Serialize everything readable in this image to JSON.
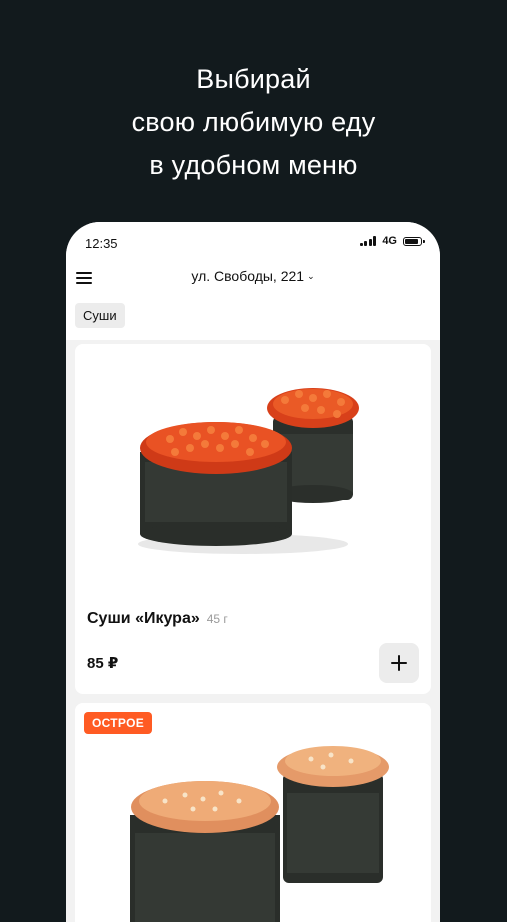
{
  "promo": {
    "line1": "Выбирай",
    "line2": "свою любимую еду",
    "line3": "в удобном меню"
  },
  "status_bar": {
    "time": "12:35",
    "network": "4G"
  },
  "header": {
    "address": "ул. Свободы, 221",
    "menu_icon": "hamburger-menu-icon",
    "chevron_icon": "chevron-down-icon"
  },
  "category": {
    "label": "Суши"
  },
  "products": [
    {
      "name": "Суши «Икура»",
      "weight": "45 г",
      "price": "85 ₽",
      "add_icon": "plus-icon"
    },
    {
      "badge": "ОСТРОЕ"
    }
  ],
  "colors": {
    "background": "#121a1d",
    "badge": "#ff5b23",
    "card": "#ffffff"
  }
}
